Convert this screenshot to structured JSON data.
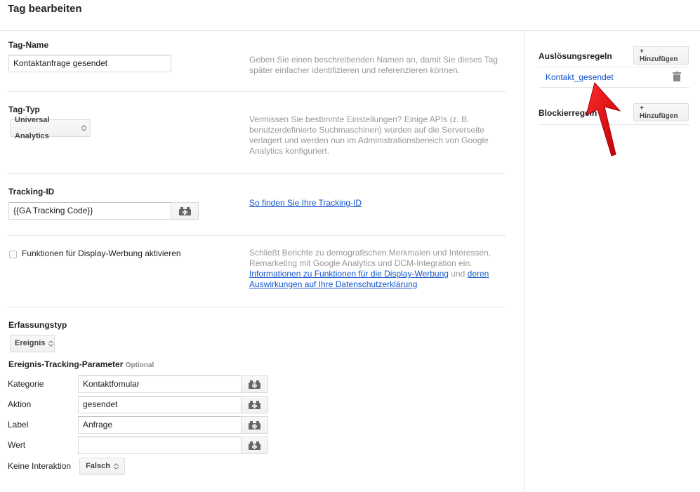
{
  "page": {
    "title": "Tag bearbeiten"
  },
  "tag_name": {
    "label": "Tag-Name",
    "value": "Kontaktanfrage gesendet",
    "help_1": "Geben Sie einen beschreibenden Namen an, damit Sie dieses Tag",
    "help_2": "später einfacher identifizieren und referenzieren können."
  },
  "tag_type": {
    "label": "Tag-Typ",
    "value": "Universal Analytics",
    "help_1": "Vermissen Sie bestimmte Einstellungen? Einige APIs (z. B.",
    "help_2": "benutzerdefinierte Suchmaschinen) wurden auf die Serverseite",
    "help_3": "verlagert und werden nun im Administrationsbereich von Google",
    "help_4": "Analytics konfiguriert."
  },
  "tracking_id": {
    "label": "Tracking-ID",
    "value": "{{GA Tracking Code}}",
    "help_link": "So finden Sie Ihre Tracking-ID"
  },
  "display_ads": {
    "label": "Funktionen für Display-Werbung aktivieren",
    "checked": false,
    "help_1": "Schließt Berichte zu demografischen Merkmalen und Interessen,",
    "help_2": "Remarketing mit Google Analytics und DCM-Integration ein.",
    "help_link_1": "Informationen zu Funktionen für die Display-Werbung",
    "help_and": "und",
    "help_link_2a": "deren",
    "help_link_2b": "Auswirkungen auf Ihre Datenschutzerklärung"
  },
  "capture_type": {
    "label": "Erfassungstyp",
    "value": "Ereignis"
  },
  "event_params": {
    "title": "Ereignis-Tracking-Parameter",
    "optional": "Optional",
    "category": {
      "label": "Kategorie",
      "value": "Kontaktfomular"
    },
    "action": {
      "label": "Aktion",
      "value": "gesendet"
    },
    "event_label": {
      "label": "Label",
      "value": "Anfrage"
    },
    "value": {
      "label": "Wert",
      "value": ""
    },
    "non_interaction": {
      "label": "Keine Interaktion",
      "value": "Falsch"
    }
  },
  "sidebar": {
    "firing_rules": {
      "title": "Auslösungsregeln",
      "add_label": "+ Hinzufügen",
      "items": [
        "Kontakt_gesendet"
      ]
    },
    "blocking_rules": {
      "title": "Blockierregeln",
      "add_label": "+ Hinzufügen"
    }
  },
  "colors": {
    "link": "#1155cc",
    "arrow": "#e8000b",
    "help_text": "#999999"
  },
  "icons": {
    "macro": "lego-brick-icon",
    "delete": "trash-icon",
    "select": "up-down-chevron-icon",
    "annotation": "red-arrow-icon"
  }
}
